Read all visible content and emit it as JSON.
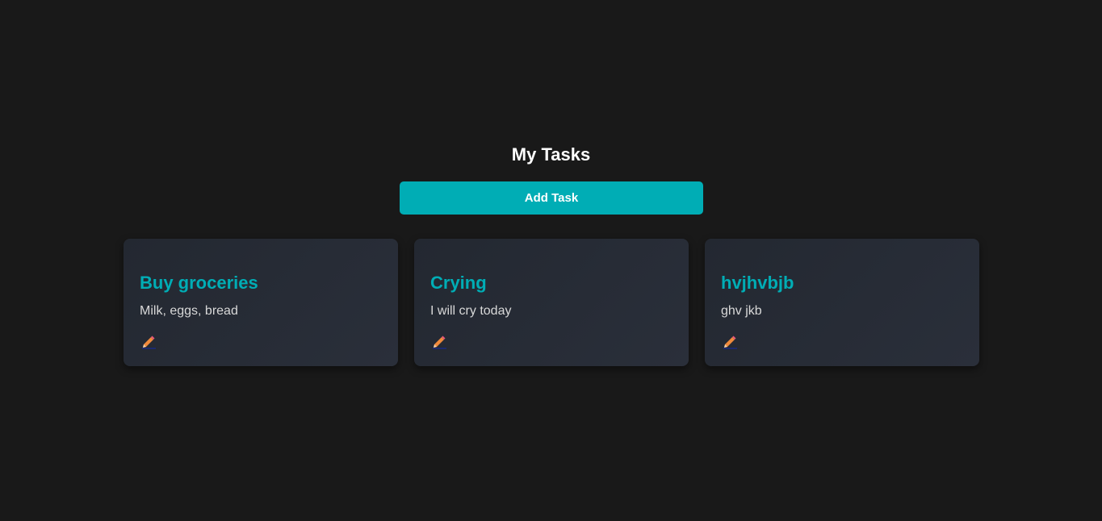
{
  "header": {
    "title": "My Tasks"
  },
  "actions": {
    "add_task_label": "Add Task"
  },
  "tasks": [
    {
      "title": "Buy groceries",
      "description": "Milk, eggs, bread",
      "edit_icon": "pencil-icon"
    },
    {
      "title": "Crying",
      "description": "I will cry today",
      "edit_icon": "pencil-icon"
    },
    {
      "title": "hvjhvbjb",
      "description": "ghv jkb",
      "edit_icon": "pencil-icon"
    }
  ],
  "colors": {
    "background": "#191919",
    "accent": "#00adb5",
    "card": "#262b35",
    "title_text": "#ffffff",
    "description_text": "#d8d8d8"
  }
}
